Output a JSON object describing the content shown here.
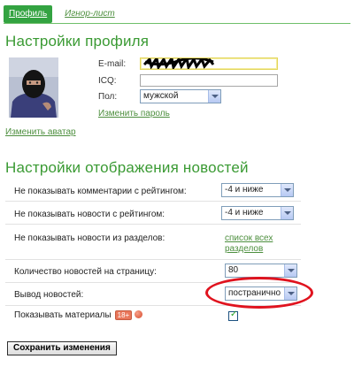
{
  "tabs": [
    {
      "label": "Профиль",
      "active": true
    },
    {
      "label": "Игнор-лист",
      "active": false
    }
  ],
  "profile": {
    "title": "Настройки профиля",
    "email_label": "E-mail:",
    "icq_label": "ICQ:",
    "icq_value": "",
    "gender_label": "Пол:",
    "gender_value": "мужской",
    "change_password": "Изменить пароль",
    "change_avatar": "Изменить аватар"
  },
  "news": {
    "title": "Настройки отображения новостей",
    "rows": [
      {
        "label": "Не показывать комментарии с рейтингом:",
        "value": "-4 и ниже"
      },
      {
        "label": "Не показывать новости с рейтингом:",
        "value": "-4 и ниже"
      },
      {
        "label": "Не показывать новости из разделов:",
        "link": "список всех разделов"
      },
      {
        "label": "Количество новостей на страницу:",
        "value": "80"
      },
      {
        "label": "Вывод новостей:",
        "value": "постранично"
      },
      {
        "label": "Показывать материалы",
        "badge": "18+",
        "checked": true
      }
    ]
  },
  "save_button": "Сохранить изменения",
  "colors": {
    "accent": "#3a9a33",
    "link": "#4d8f3e",
    "highlight": "#e0131e"
  }
}
